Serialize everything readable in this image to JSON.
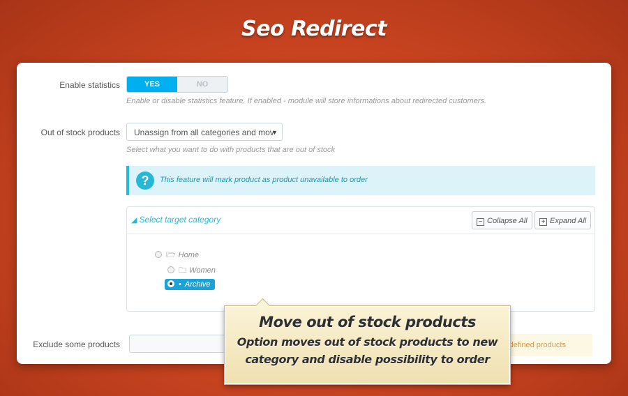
{
  "title": "Seo Redirect",
  "statistics": {
    "label": "Enable statistics",
    "yes": "YES",
    "no": "NO",
    "selected": "YES",
    "help": "Enable or disable statistics feature. If enabled - module will store informations about redirected customers."
  },
  "out_of_stock": {
    "label": "Out of stock products",
    "selected": "Unassign from all categories and mov",
    "help": "Select what you want to do with products that are out of stock"
  },
  "alert": {
    "icon": "question-icon",
    "text": "This feature will mark product as product unavailable to order"
  },
  "tree": {
    "title": "Select target category",
    "collapse_label": "Collapse All",
    "expand_label": "Expand All",
    "nodes": [
      {
        "label": "Home"
      },
      {
        "label": "Women"
      },
      {
        "label": "Archive",
        "selected": true
      }
    ]
  },
  "exclude": {
    "label": "Exclude some products",
    "value": "",
    "warning": "ct defined products"
  },
  "callout": {
    "heading": "Move out of stock products",
    "line1": "Option moves out of stock products to new",
    "line2": "category and disable possibility to order"
  },
  "colors": {
    "accent": "#00aff0",
    "background": "#d14a24",
    "callout": "#f5e8c0"
  }
}
